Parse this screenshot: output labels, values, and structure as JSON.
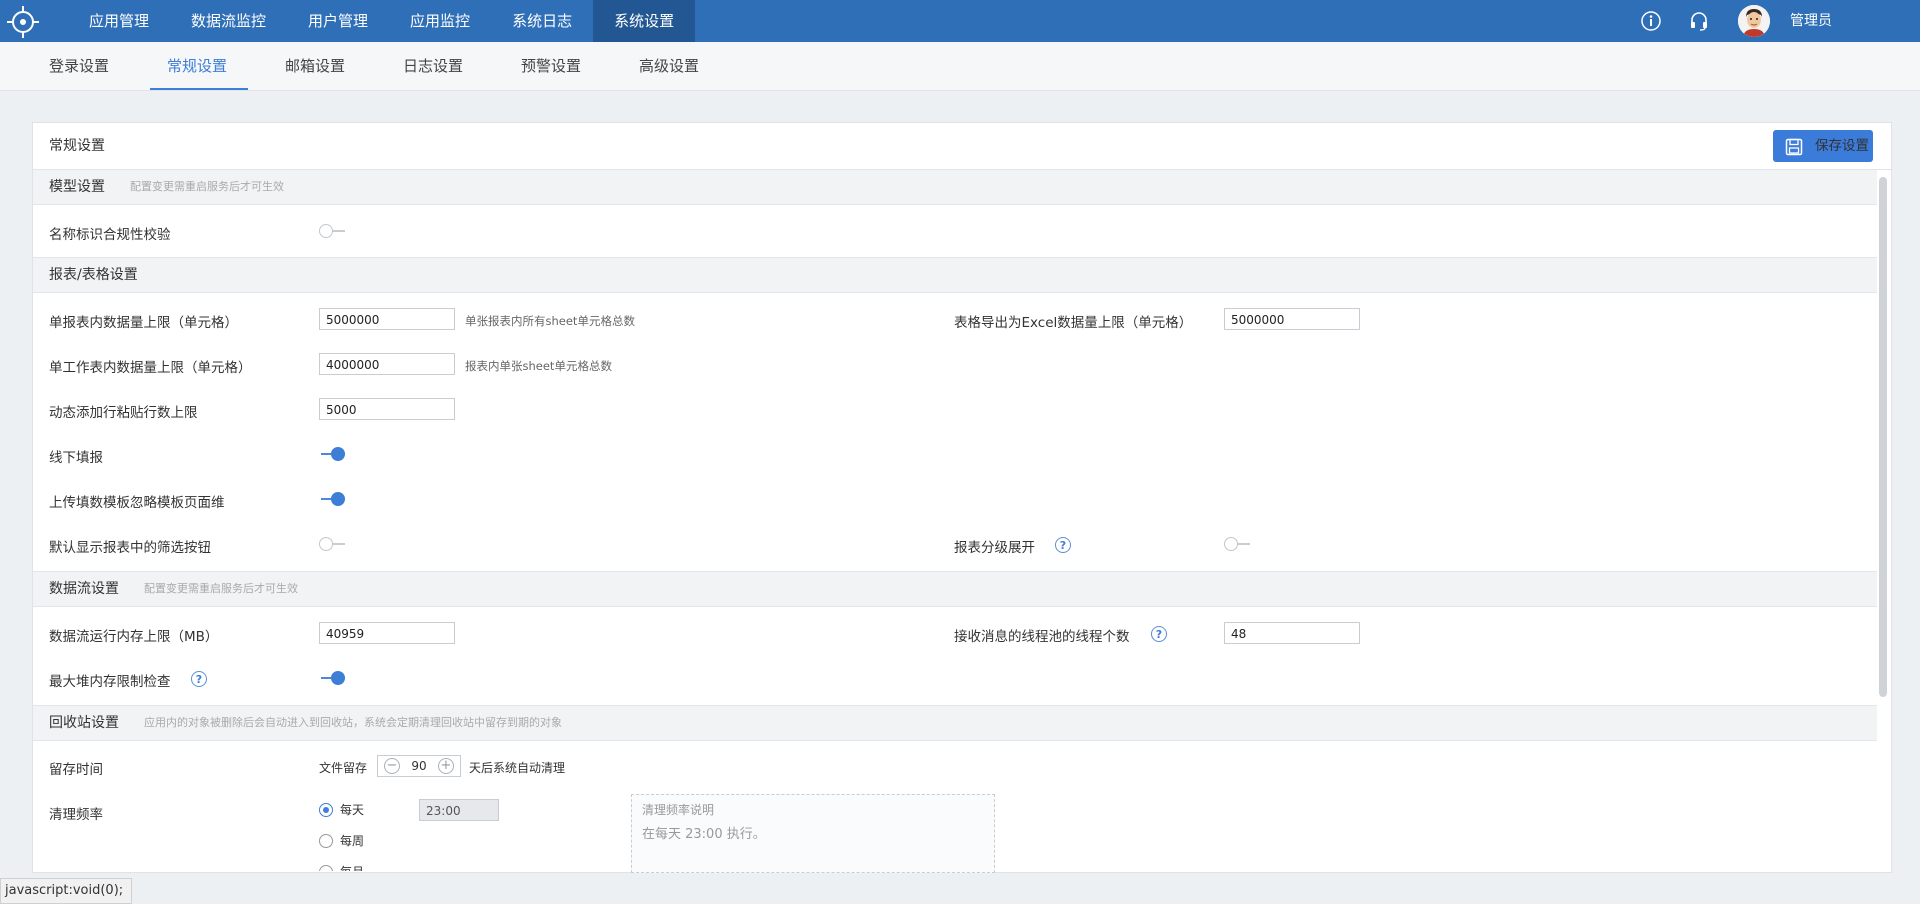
{
  "nav": {
    "items": [
      "应用管理",
      "数据流监控",
      "用户管理",
      "应用监控",
      "系统日志",
      "系统设置"
    ],
    "active": "系统设置",
    "user": "管理员"
  },
  "subtabs": {
    "items": [
      "登录设置",
      "常规设置",
      "邮箱设置",
      "日志设置",
      "预警设置",
      "高级设置"
    ],
    "active": "常规设置"
  },
  "panel": {
    "title": "常规设置",
    "save_label": "保存设置"
  },
  "sections": {
    "model": {
      "title": "模型设置",
      "hint": "配置变更需重启服务后才可生效"
    },
    "report": {
      "title": "报表/表格设置"
    },
    "dataflow": {
      "title": "数据流设置",
      "hint": "配置变更需重启服务后才可生效"
    },
    "recycle": {
      "title": "回收站设置",
      "hint": "应用内的对象被删除后会自动进入到回收站，系统会定期清理回收站中留存到期的对象"
    }
  },
  "fields": {
    "name_check": {
      "label": "名称标识合规性校验",
      "on": false
    },
    "single_report_limit": {
      "label": "单报表内数据量上限（单元格）",
      "value": "5000000",
      "hint": "单张报表内所有sheet单元格总数"
    },
    "excel_export_limit": {
      "label": "表格导出为Excel数据量上限（单元格）",
      "value": "5000000"
    },
    "single_sheet_limit": {
      "label": "单工作表内数据量上限（单元格）",
      "value": "4000000",
      "hint": "报表内单张sheet单元格总数"
    },
    "dynamic_paste_limit": {
      "label": "动态添加行粘贴行数上限",
      "value": "5000"
    },
    "offline_fill": {
      "label": "线下填报",
      "on": true
    },
    "ignore_page_dim": {
      "label": "上传填数模板忽略模板页面维",
      "on": true
    },
    "show_filter_btn": {
      "label": "默认显示报表中的筛选按钮",
      "on": false
    },
    "report_level_expand": {
      "label": "报表分级展开",
      "on": false,
      "help": "?"
    },
    "dataflow_memory": {
      "label": "数据流运行内存上限（MB）",
      "value": "40959"
    },
    "thread_pool": {
      "label": "接收消息的线程池的线程个数",
      "value": "48",
      "help": "?"
    },
    "max_heap_check": {
      "label": "最大堆内存限制检查",
      "on": true,
      "help": "?"
    },
    "retention": {
      "label": "留存时间",
      "prefix": "文件留存",
      "value": "90",
      "suffix": "天后系统自动清理"
    },
    "clean_freq": {
      "label": "清理频率",
      "options": [
        "每天",
        "每周",
        "每月"
      ],
      "selected": "每天",
      "time": "23:00",
      "note_title": "清理频率说明",
      "note_text": "在每天 23:00 执行。"
    }
  },
  "statusbar": "javascript:void(0);",
  "colors": {
    "brand": "#2f6fb7",
    "accent": "#3d7ed6"
  }
}
